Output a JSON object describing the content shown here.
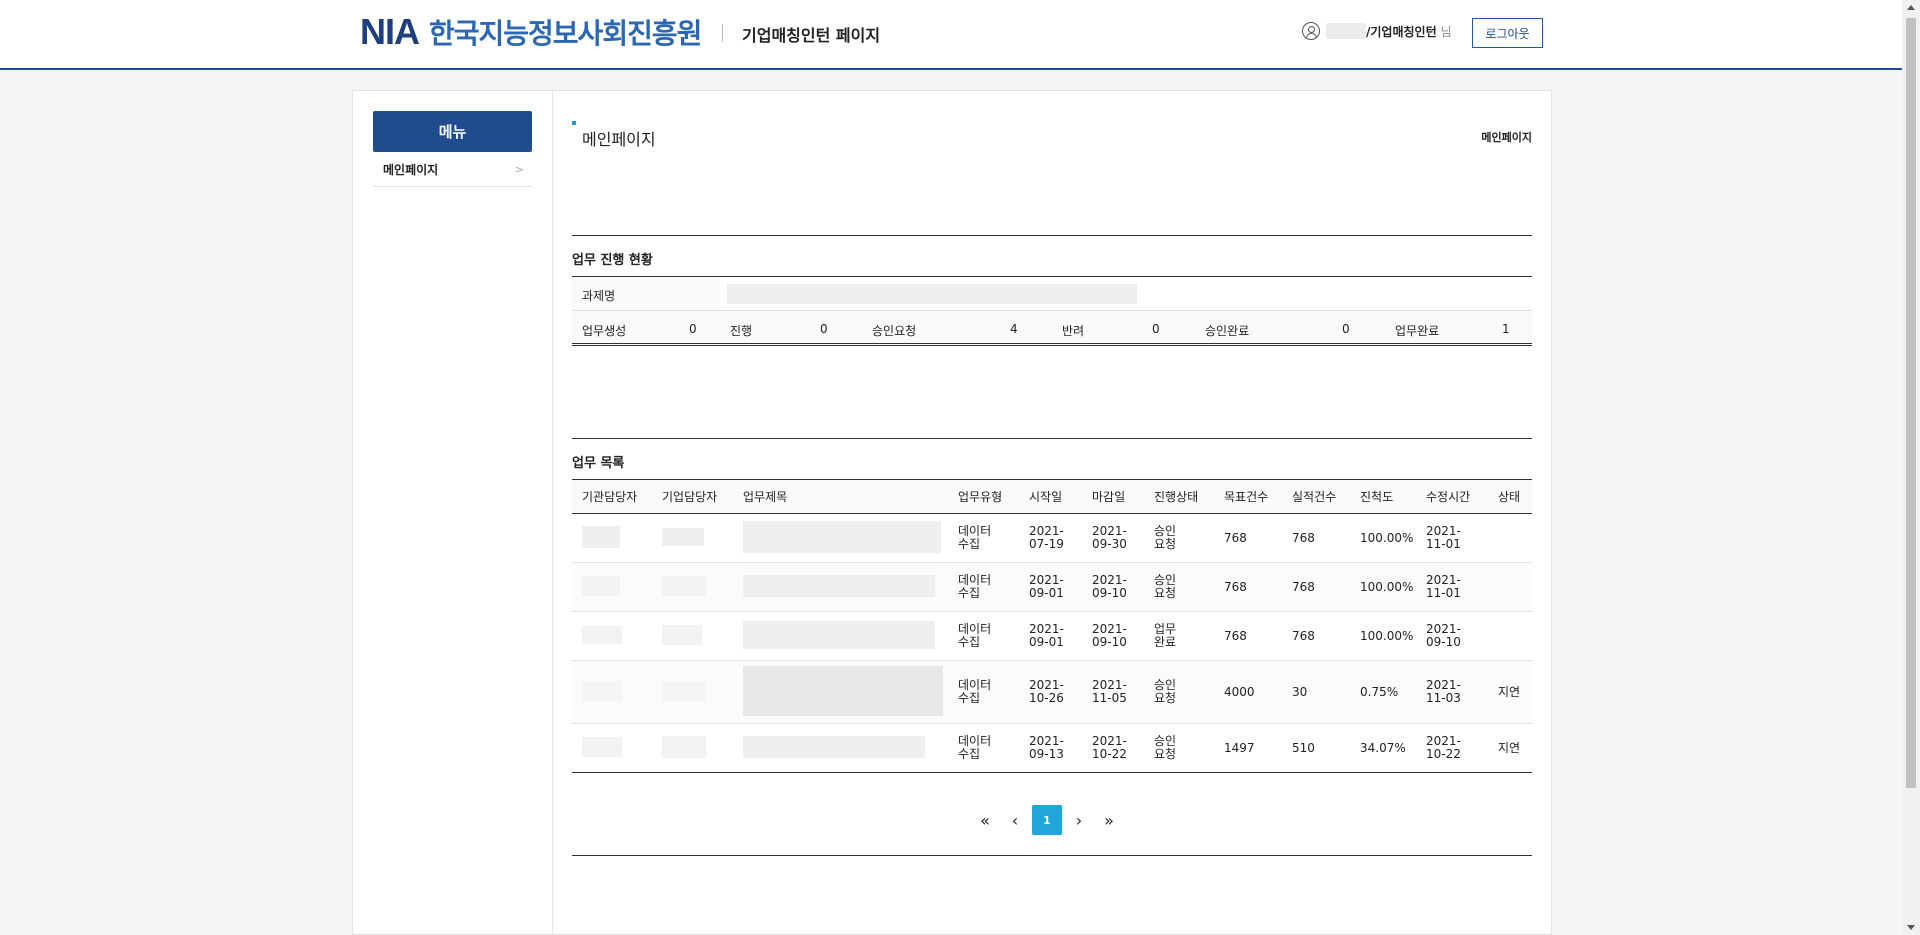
{
  "header": {
    "logo_nia": "NIA",
    "logo_org": "한국지능정보사회진흥원",
    "page_name": "기업매칭인턴 페이지",
    "user_name": "/기업매칭인턴",
    "user_suffix": "님",
    "logout_label": "로그아웃"
  },
  "sidebar": {
    "menu_title": "메뉴",
    "items": [
      {
        "label": "메인페이지",
        "chevron": ">"
      }
    ]
  },
  "main": {
    "title": "메인페이지",
    "breadcrumb": "메인페이지",
    "status_section": {
      "title": "업무 진행 현황",
      "project_label": "과제명",
      "counts": [
        {
          "label": "업무생성",
          "value": "0"
        },
        {
          "label": "진행",
          "value": "0"
        },
        {
          "label": "승인요청",
          "value": "4"
        },
        {
          "label": "반려",
          "value": "0"
        },
        {
          "label": "승인완료",
          "value": "0"
        },
        {
          "label": "업무완료",
          "value": "1"
        }
      ]
    },
    "task_section": {
      "title": "업무 목록",
      "columns": [
        "기관담당자",
        "기업담당자",
        "업무제목",
        "업무유형",
        "시작일",
        "마감일",
        "진행상태",
        "목표건수",
        "실적건수",
        "진척도",
        "수정시간",
        "상태"
      ],
      "rows": [
        {
          "type": "데이터 수집",
          "start": "2021-07-19",
          "end": "2021-09-30",
          "progress_state": "승인 요청",
          "target": "768",
          "actual": "768",
          "rate": "100.00%",
          "modified": "2021-11-01",
          "status": ""
        },
        {
          "type": "데이터 수집",
          "start": "2021-09-01",
          "end": "2021-09-10",
          "progress_state": "승인 요청",
          "target": "768",
          "actual": "768",
          "rate": "100.00%",
          "modified": "2021-11-01",
          "status": ""
        },
        {
          "type": "데이터 수집",
          "start": "2021-09-01",
          "end": "2021-09-10",
          "progress_state": "업무 완료",
          "target": "768",
          "actual": "768",
          "rate": "100.00%",
          "modified": "2021-09-10",
          "status": ""
        },
        {
          "type": "데이터 수집",
          "start": "2021-10-26",
          "end": "2021-11-05",
          "progress_state": "승인 요청",
          "target": "4000",
          "actual": "30",
          "rate": "0.75%",
          "modified": "2021-11-03",
          "status": "지연"
        },
        {
          "type": "데이터 수집",
          "start": "2021-09-13",
          "end": "2021-10-22",
          "progress_state": "승인 요청",
          "target": "1497",
          "actual": "510",
          "rate": "34.07%",
          "modified": "2021-10-22",
          "status": "지연"
        }
      ]
    },
    "pagination": {
      "first": "«",
      "prev": "‹",
      "current": "1",
      "next": "›",
      "last": "»"
    }
  },
  "colors": {
    "brand": "#1e4c8f",
    "accent": "#1ea7d8",
    "delay": "#d40000"
  }
}
